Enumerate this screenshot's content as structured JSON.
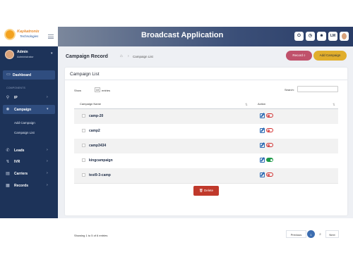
{
  "brand": {
    "line1": "Kaykatronix",
    "line2": "Technologies"
  },
  "header": {
    "title": "Broadcast Application",
    "icons": [
      "power-icon",
      "clock-icon",
      "users-icon",
      "lm-badge",
      "user-avatar"
    ],
    "lm_label": "LM"
  },
  "profile": {
    "name": "Admin",
    "role": "Administrator"
  },
  "sidebar": {
    "dashboard": "Dashboard",
    "section": "COMPONENTS",
    "items": [
      {
        "label": "IP",
        "icon": "link-icon"
      },
      {
        "label": "Campaign",
        "icon": "broadcast-icon"
      },
      {
        "label": "Leads",
        "icon": "phone-icon"
      },
      {
        "label": "IVR",
        "icon": "ivr-icon"
      },
      {
        "label": "Carriers",
        "icon": "carrier-icon"
      },
      {
        "label": "Records",
        "icon": "records-icon"
      }
    ],
    "subitems": [
      "Add Campaign",
      "Campaign List"
    ]
  },
  "page": {
    "title": "Campaign Record",
    "breadcrumb": "Campaign List",
    "record_button": "Record",
    "add_button": "Add Campaign"
  },
  "card": {
    "title": "Campaign List",
    "show_label": "Show",
    "show_value": "10",
    "entries_label": "entries",
    "search_label": "Search:",
    "columns": [
      "Campaign Name",
      "Action"
    ],
    "rows": [
      {
        "name": "camp-20",
        "active": false
      },
      {
        "name": "camp2",
        "active": false
      },
      {
        "name": "camp3434",
        "active": false
      },
      {
        "name": "kingcampaign",
        "active": true
      },
      {
        "name": "test9-3-camp",
        "active": false
      }
    ],
    "delete_label": "Delete",
    "footer_info": "Showing 1 to 5 of 6 entries",
    "pager": {
      "prev": "Previous",
      "pages": [
        "1",
        "2"
      ],
      "next": "Next"
    }
  },
  "colors": {
    "sidebar": "#1d3359",
    "accent_record": "#c0516b",
    "accent_add": "#e1ae2c",
    "delete": "#c0392b",
    "active_page": "#3c6db0"
  }
}
